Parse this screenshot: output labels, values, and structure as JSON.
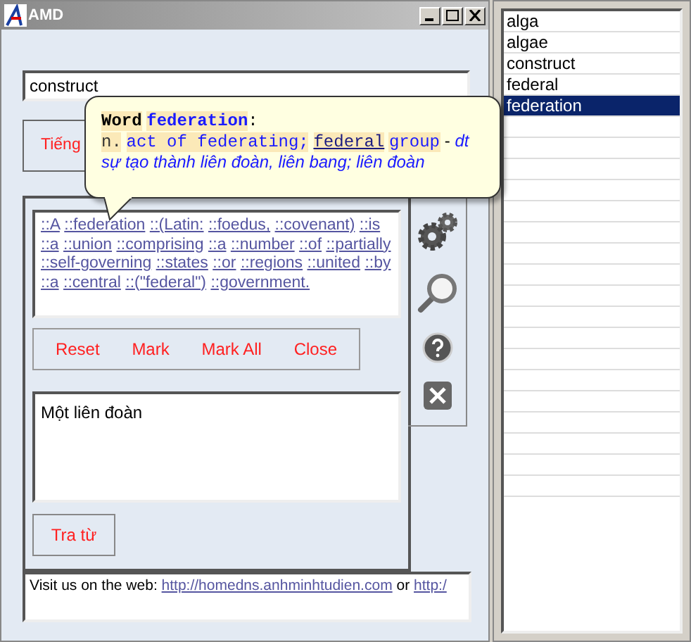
{
  "window": {
    "title": "AMD"
  },
  "search": {
    "value": "construct"
  },
  "language_button": {
    "label": "Tiếng"
  },
  "tooltip": {
    "label": "Word",
    "word": "federation",
    "colon": ":",
    "pos": "n.",
    "gloss": "act of federating;",
    "link": "federal",
    "gloss_rest": "group",
    "dash": "-",
    "type_abbr": "dt",
    "translation": "sự tạo thành liên đoàn, liên bang; liên đoàn"
  },
  "definition_words": [
    "::A",
    "::federation",
    "::(Latin:",
    "::foedus,",
    "::covenant)",
    "::is",
    "::a",
    "::union",
    "::comprising",
    "::a",
    "::number",
    "::of",
    "::partially",
    "::self-governing",
    "::states",
    "::or",
    "::regions",
    "::united",
    "::by",
    "::a",
    "::central",
    "::(\"federal\")",
    "::government."
  ],
  "actions": [
    {
      "label": "Reset"
    },
    {
      "label": "Mark"
    },
    {
      "label": "Mark All"
    },
    {
      "label": "Close"
    }
  ],
  "note": {
    "value": "Một liên đoàn"
  },
  "lookup_button": {
    "label": "Tra từ"
  },
  "footer": {
    "text": "Visit us on the web:",
    "link": "http://homedns.anhminhtudien.com",
    "or": "or",
    "link_2": "http:/"
  },
  "word_list": [
    {
      "label": "alga",
      "selected": false
    },
    {
      "label": "algae",
      "selected": false
    },
    {
      "label": "construct",
      "selected": false
    },
    {
      "label": "federal",
      "selected": false
    },
    {
      "label": "federation",
      "selected": true
    }
  ]
}
